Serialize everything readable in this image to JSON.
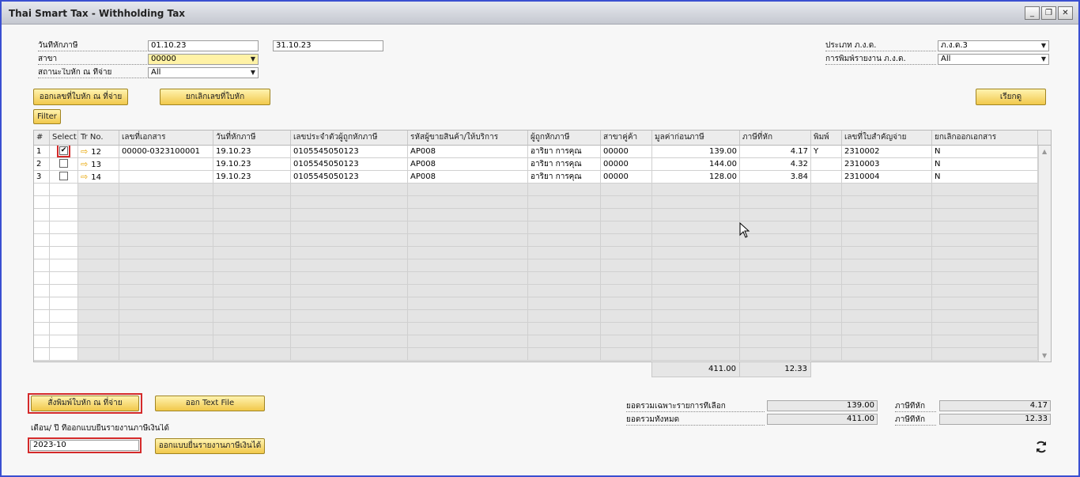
{
  "window": {
    "title": "Thai Smart Tax - Withholding Tax",
    "minimize": "_",
    "restore": "❐",
    "close": "✕"
  },
  "form": {
    "date_label": "วันที่หักภาษี",
    "date_from": "01.10.23",
    "date_to": "31.10.23",
    "branch_label": "สาขา",
    "branch_value": "00000",
    "status_label": "สถานะใบหัก ณ ที่จ่าย",
    "status_value": "All",
    "pnd_type_label": "ประเภท ภ.ง.ด.",
    "pnd_type_value": "ภ.ง.ด.3",
    "print_report_label": "การพิมพ์รายงาน ภ.ง.ด.",
    "print_report_value": "All"
  },
  "buttons": {
    "issue_cert": "ออกเลขที่ใบหัก ณ ที่จ่าย",
    "cancel_cert": "ยกเลิกเลขที่ใบหัก",
    "retrieve": "เรียกดู",
    "filter": "Filter",
    "print_cert": "สั่งพิมพ์ใบหัก ณ ที่จ่าย",
    "text_file": "ออก Text File",
    "income_form": "ออกแบบยื่นรายงานภาษีเงินได้"
  },
  "grid": {
    "columns": [
      "#",
      "Select",
      "Tr No.",
      "เลขที่เอกสาร",
      "วันที่หักภาษี",
      "เลขประจำตัวผู้ถูกหักภาษี",
      "รหัสผู้ขายสินค้า/ให้บริการ",
      "ผู้ถูกหักภาษี",
      "สาขาคู่ค้า",
      "มูลค่าก่อนภาษี",
      "ภาษีที่หัก",
      "พิมพ์",
      "เลขที่ใบสำคัญจ่าย",
      "ยกเลิกออกเอกสาร"
    ],
    "rows": [
      {
        "no": "1",
        "checked": true,
        "tr": "12",
        "doc": "00000-0323100001",
        "date": "19.10.23",
        "taxid": "0105545050123",
        "vendor": "AP008",
        "name": "อาริยา การคุณ",
        "branch": "00000",
        "amount": "139.00",
        "tax": "4.17",
        "printed": "Y",
        "voucher": "2310002",
        "cancel": "N"
      },
      {
        "no": "2",
        "checked": false,
        "tr": "13",
        "doc": "",
        "date": "19.10.23",
        "taxid": "0105545050123",
        "vendor": "AP008",
        "name": "อาริยา การคุณ",
        "branch": "00000",
        "amount": "144.00",
        "tax": "4.32",
        "printed": "",
        "voucher": "2310003",
        "cancel": "N"
      },
      {
        "no": "3",
        "checked": false,
        "tr": "14",
        "doc": "",
        "date": "19.10.23",
        "taxid": "0105545050123",
        "vendor": "AP008",
        "name": "อาริยา การคุณ",
        "branch": "00000",
        "amount": "128.00",
        "tax": "3.84",
        "printed": "",
        "voucher": "2310004",
        "cancel": "N"
      }
    ],
    "total_amount": "411.00",
    "total_tax": "12.33"
  },
  "summary": {
    "selected_label": "ยอดรวมเฉพาะรายการที่เลือก",
    "selected_amount": "139.00",
    "selected_tax_label": "ภาษีที่หัก",
    "selected_tax": "4.17",
    "all_label": "ยอดรวมทั้งหมด",
    "all_amount": "411.00",
    "all_tax_label": "ภาษีที่หัก",
    "all_tax": "12.33"
  },
  "period": {
    "label": "เดือน/ ปี ที่ออกแบบยื่นรายงานภาษีเงินได้",
    "value": "2023-10"
  },
  "icons": {
    "refresh": "refresh-icon",
    "row_link": "arrow-right-icon",
    "dropdown": "chevron-down-icon"
  },
  "colors": {
    "button_gradient_top": "#fff3b0",
    "button_gradient_bottom": "#f1c84b",
    "highlight_field": "#fff2a6",
    "red_highlight": "#d42a2a",
    "window_border": "#3a4fd1"
  }
}
